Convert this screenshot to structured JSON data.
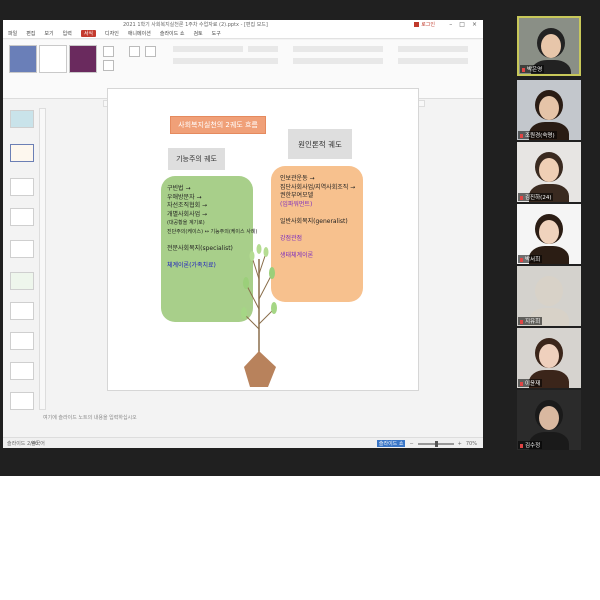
{
  "window": {
    "title": "2021 1학기 사회복지실천론 1주차 수업자료 (2).pptx - [편집 모드]",
    "account": "로그인",
    "menu_tabs": [
      "파일",
      "편집",
      "보기",
      "입력",
      "서식",
      "디자인",
      "애니메이션",
      "슬라이드 쇼",
      "검토",
      "도구"
    ]
  },
  "status": {
    "slide_count": "슬라이드 2/40",
    "lang": "한국어",
    "notes_placeholder": "여기에 슬라이드 노트의 내용을 입력하십시오",
    "zoom": "70%",
    "mode_button": "슬라이드 쇼"
  },
  "slide": {
    "title": "사회복지실천의 2궤도 흐름",
    "green_label": "기능주의 궤도",
    "orange_label": "원인론적 궤도",
    "green_items": [
      {
        "text": "구빈법 →",
        "cls": ""
      },
      {
        "text": "우애방문자 →",
        "cls": ""
      },
      {
        "text": "자선조직협회 →",
        "cls": ""
      },
      {
        "text": "개별사회사업 →",
        "cls": ""
      },
      {
        "text": "(대공황을 계기로)",
        "cls": "sm"
      },
      {
        "text": "진단주의(케이스) ↔ 기능주의(케이스 사례)",
        "cls": "sm"
      },
      {
        "text": "",
        "cls": ""
      },
      {
        "text": "전문사회복지(specialist)",
        "cls": ""
      },
      {
        "text": "",
        "cls": ""
      },
      {
        "text": "체계이론(가족치료)",
        "cls": "b"
      }
    ],
    "orange_items": [
      {
        "text": "인보관운동 →",
        "cls": ""
      },
      {
        "text": "집단사회사업/지역사회조직 →",
        "cls": ""
      },
      {
        "text": "권한부여모델",
        "cls": ""
      },
      {
        "text": "(임파워먼트)",
        "cls": "p"
      },
      {
        "text": "",
        "cls": ""
      },
      {
        "text": "일반사회복지(generalist)",
        "cls": ""
      },
      {
        "text": "",
        "cls": ""
      },
      {
        "text": "강점관점",
        "cls": "p"
      },
      {
        "text": "",
        "cls": ""
      },
      {
        "text": "생태체계이론",
        "cls": "p"
      }
    ]
  },
  "participants": [
    {
      "name": "박은영",
      "bg": "#8a8f86",
      "face": "#e7c6aa",
      "hair": "#222"
    },
    {
      "name": "조원경(숙명)",
      "bg": "#c3c7cc",
      "face": "#e5c4a8",
      "hair": "#2a1c14"
    },
    {
      "name": "김진하(24)",
      "bg": "#e7e5e3",
      "face": "#efcfb5",
      "hair": "#3a2a20"
    },
    {
      "name": "박서희",
      "bg": "#f5f5f5",
      "face": "#f0d3bd",
      "hair": "#2b1d14"
    },
    {
      "name": "지유희",
      "bg": "#d4d2cd",
      "face": "#d8d2c8",
      "hair": "#d8d2c8"
    },
    {
      "name": "이윤재",
      "bg": "#d6d3cf",
      "face": "#efd0bd",
      "hair": "#3b251a"
    },
    {
      "name": "김수정",
      "bg": "#2b2b2b",
      "face": "#d9b8a0",
      "hair": "#1a1a1a"
    }
  ]
}
